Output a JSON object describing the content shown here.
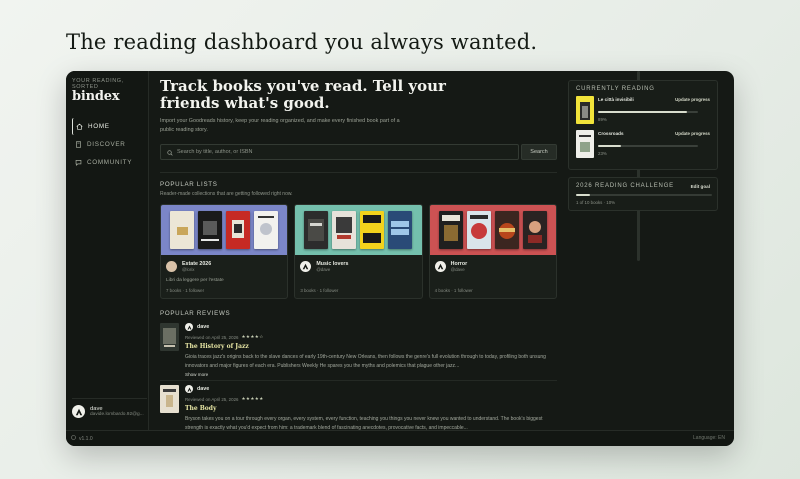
{
  "hero": {
    "heading": "The reading dashboard you always wanted."
  },
  "app": {
    "tagline": "YOUR READING, SORTED",
    "logo": "bindex",
    "nav": [
      {
        "label": "HOME",
        "icon": "home-icon",
        "active": true
      },
      {
        "label": "DISCOVER",
        "icon": "book-icon",
        "active": false
      },
      {
        "label": "COMMUNITY",
        "icon": "chat-icon",
        "active": false
      }
    ],
    "user": {
      "name": "dave",
      "email": "davide.lombardo.92@g..."
    },
    "footer": {
      "version": "v1.1.0",
      "language": "Language: EN"
    }
  },
  "main": {
    "title": "Track books you've read. Tell your friends what's good.",
    "subtitle": "Import your Goodreads history, keep your reading organized, and make every finished book part of a public reading story.",
    "search": {
      "placeholder": "Search by title, author, or ISBN",
      "button_label": "Search"
    },
    "popular_lists": {
      "title": "POPULAR LISTS",
      "subtitle": "Reader-made collections that are getting followed right now.",
      "items": [
        {
          "name": "Estate 2026",
          "handle": "@lorix",
          "description": "Libri da leggere per l'estate",
          "meta": "7 books · 1 follower",
          "bg": "#7b86c8"
        },
        {
          "name": "Music lovers",
          "handle": "@dave",
          "description": "",
          "meta": "3 books · 1 follower",
          "bg": "#74c0ad"
        },
        {
          "name": "Horror",
          "handle": "@dave",
          "description": "",
          "meta": "4 books · 1 follower",
          "bg": "#cc5253"
        }
      ]
    },
    "popular_reviews": {
      "title": "POPULAR REVIEWS",
      "items": [
        {
          "user": "dave",
          "date": "Reviewed on April 25, 2026",
          "stars": "★★★★☆",
          "book": "The History of Jazz",
          "text": "Gioia traces jazz's origins back to the slave dances of early 19th-century New Orleans, then follows the genre's full evolution through to today, profiling both unsung innovators and major figures of each era. Publishers Weekly He spares you the myths and polemics that plague other jazz...",
          "show_more": "Show more"
        },
        {
          "user": "dave",
          "date": "Reviewed on April 25, 2026",
          "stars": "★★★★★",
          "book": "The Body",
          "text": "Bryson takes you on a tour through every organ, every system, every function, teaching you things you never knew you wanted to understand. The book's biggest strength is exactly what you'd expect from him: a trademark blend of fascinating anecdotes, provocative facts, and impeccable...",
          "show_more": ""
        }
      ]
    }
  },
  "right": {
    "currently_reading": {
      "title": "CURRENTLY READING",
      "items": [
        {
          "title": "Le città invisibili",
          "update_label": "Update progress",
          "progress": 0.89,
          "percent_label": "89%"
        },
        {
          "title": "Crossroads",
          "update_label": "Update progress",
          "progress": 0.23,
          "percent_label": "23%"
        }
      ]
    },
    "challenge": {
      "title": "2026 READING CHALLENGE",
      "edit_label": "Edit goal",
      "progress": 0.1,
      "status": "1 of 10 books · 10%"
    }
  },
  "colors": {
    "accent": "#e7e6a4",
    "app_bg": "#151915",
    "sidebar_bg": "#131713"
  }
}
